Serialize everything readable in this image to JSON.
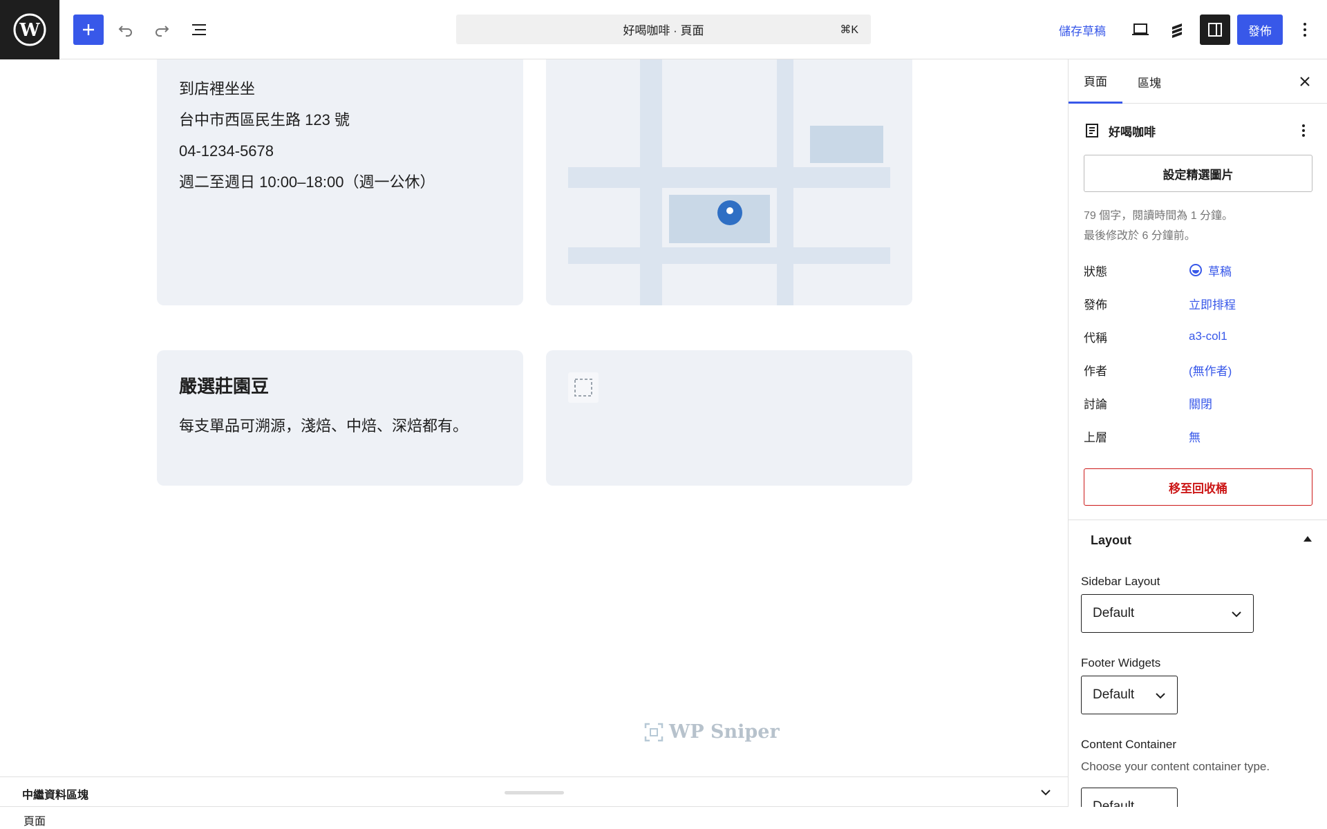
{
  "topbar": {
    "document_title": "好喝咖啡 · 頁面",
    "shortcut": "⌘K",
    "save_draft": "儲存草稿",
    "publish": "發佈"
  },
  "canvas": {
    "visit": {
      "heading": "到店裡坐坐",
      "address": "台中市西區民生路 123 號",
      "phone": "04-1234-5678",
      "hours": "週二至週日 10:00–18:00（週一公休）"
    },
    "beans": {
      "title": "嚴選莊園豆",
      "text": "每支單品可溯源，淺焙、中焙、深焙都有。"
    },
    "watermark": "WP Sniper"
  },
  "bottom": {
    "panel_title": "中繼資料區塊",
    "breadcrumb": "頁面"
  },
  "sidebar": {
    "tabs": [
      "頁面",
      "區塊"
    ],
    "doc_title": "好喝咖啡",
    "featured_image": "設定精選圖片",
    "meta_line1": "79 個字，閱讀時間為 1 分鐘。",
    "meta_line2": "最後修改於 6 分鐘前。",
    "props": [
      {
        "label": "狀態",
        "value": "草稿"
      },
      {
        "label": "發佈",
        "value": "立即排程"
      },
      {
        "label": "代稱",
        "value": "a3-col1"
      },
      {
        "label": "作者",
        "value": "(無作者)"
      },
      {
        "label": "討論",
        "value": "關閉"
      },
      {
        "label": "上層",
        "value": "無"
      }
    ],
    "trash": "移至回收桶",
    "layout": {
      "title": "Layout",
      "sidebar_layout_label": "Sidebar Layout",
      "sidebar_layout_value": "Default",
      "footer_widgets_label": "Footer Widgets",
      "footer_widgets_value": "Default",
      "content_container_label": "Content Container",
      "content_container_help": "Choose your content container type.",
      "content_container_value": "Default"
    }
  },
  "colors": {
    "accent": "#3858e9",
    "danger": "#cc1818",
    "card_bg": "#eef1f6"
  }
}
